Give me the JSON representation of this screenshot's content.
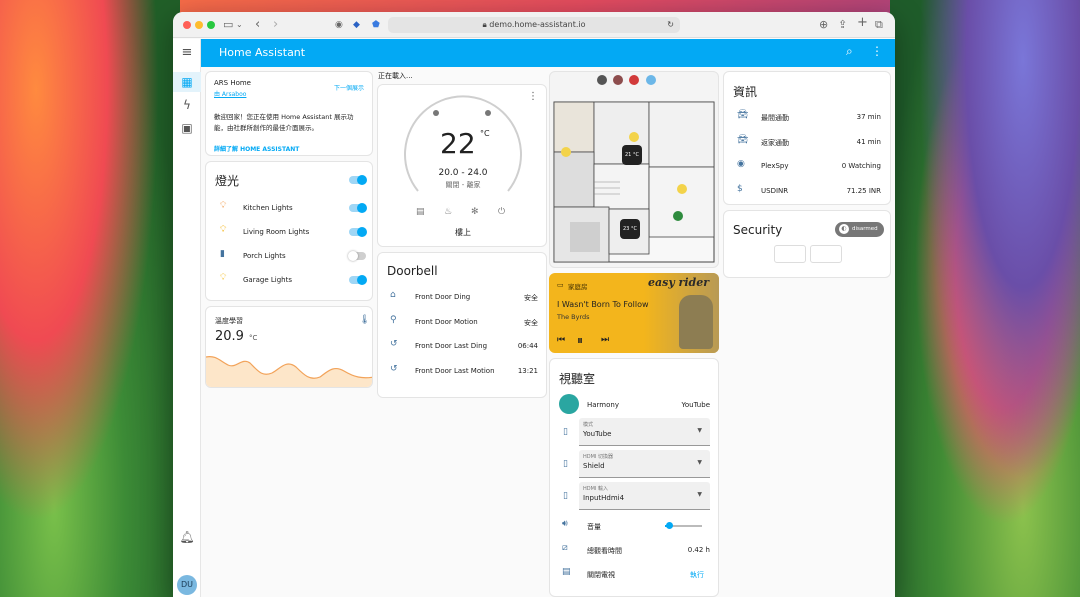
{
  "browser": {
    "url": "demo.home-assistant.io"
  },
  "app": {
    "title": "Home Assistant"
  },
  "sidebar": {
    "user_initials": "DU"
  },
  "welcome": {
    "home_name": "ARS Home",
    "author": "由 Arsaboo",
    "next_link": "下一個展示",
    "message": "歡迎回家！您正在使用 Home Assistant 展示功能，由社群所創作的最佳介面展示。",
    "learn_more": "詳細了解 HOME ASSISTANT"
  },
  "loading_text": "正在載入...",
  "lights": {
    "title": "燈光",
    "items": [
      {
        "label": "Kitchen Lights",
        "on": true,
        "color": "#f2a35a"
      },
      {
        "label": "Living Room Lights",
        "on": true,
        "color": "#f3b51c"
      },
      {
        "label": "Porch Lights",
        "on": false,
        "color": "#44739e"
      },
      {
        "label": "Garage Lights",
        "on": true,
        "color": "#f5c542"
      }
    ]
  },
  "temperature": {
    "title": "溫度學習",
    "value": "20.9",
    "unit": "°C"
  },
  "thermostat": {
    "value": "22",
    "unit": "°C",
    "range": "20.0 - 24.0",
    "mode": "關閉 - 離家",
    "name": "樓上"
  },
  "doorbell": {
    "title": "Doorbell",
    "items": [
      {
        "label": "Front Door Ding",
        "value": "安全"
      },
      {
        "label": "Front Door Motion",
        "value": "安全"
      },
      {
        "label": "Front Door Last Ding",
        "value": "06:44"
      },
      {
        "label": "Front Door Last Motion",
        "value": "13:21"
      }
    ]
  },
  "floorplan": {
    "temp1": "21 °C",
    "temp2": "23 °C"
  },
  "media": {
    "source": "家庭房",
    "song": "I Wasn't Born To Follow",
    "artist": "The Byrds",
    "art_text": "easy rider"
  },
  "theater": {
    "title": "視聽室",
    "harmony_label": "Harmony",
    "harmony_value": "YouTube",
    "selects": [
      {
        "label": "模式",
        "value": "YouTube"
      },
      {
        "label": "HDMI 切換器",
        "value": "Shield"
      },
      {
        "label": "HDMI 輸入",
        "value": "InputHdmi4"
      }
    ],
    "volume_label": "音量",
    "volume_level": 0.12,
    "watch_label": "總觀看時間",
    "watch_value": "0.42 h",
    "tv_label": "關閉電視",
    "tv_action": "執行"
  },
  "info": {
    "title": "資訊",
    "items": [
      {
        "label": "最間通勤",
        "value": "37 min",
        "icon": "car-icon"
      },
      {
        "label": "返家通勤",
        "value": "41 min",
        "icon": "car-icon"
      },
      {
        "label": "PlexSpy",
        "value": "0 Watching",
        "icon": "eye-icon"
      },
      {
        "label": "USDINR",
        "value": "71.25 INR",
        "icon": "dollar-icon"
      }
    ]
  },
  "security": {
    "title": "Security",
    "state": "disarmed"
  }
}
